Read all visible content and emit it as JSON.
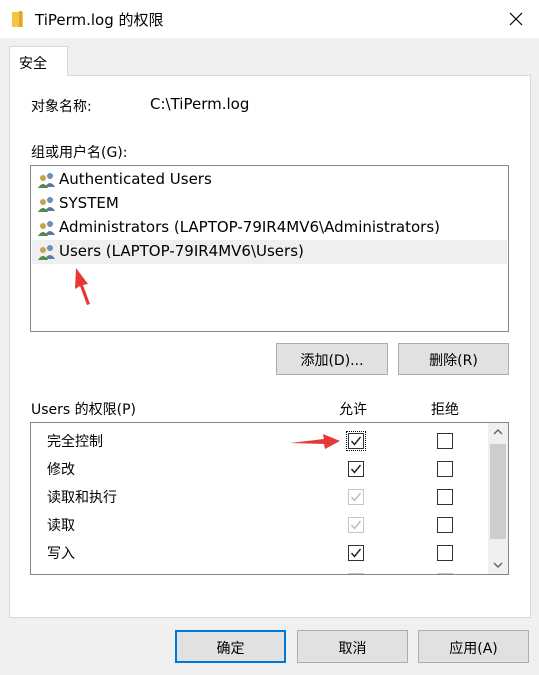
{
  "window": {
    "title": "TiPerm.log 的权限",
    "icons": {
      "title": "folder-icon",
      "close": "close-icon"
    }
  },
  "tabs": [
    {
      "label": "安全",
      "active": true
    }
  ],
  "object": {
    "label": "对象名称:",
    "value": "C:\\TiPerm.log"
  },
  "groups": {
    "label": "组或用户名(G):",
    "items": [
      {
        "name": "Authenticated Users",
        "icon": "users-group-icon",
        "selected": false
      },
      {
        "name": "SYSTEM",
        "icon": "users-group-icon",
        "selected": false
      },
      {
        "name": "Administrators (LAPTOP-79IR4MV6\\Administrators)",
        "icon": "users-group-icon",
        "selected": false
      },
      {
        "name": "Users (LAPTOP-79IR4MV6\\Users)",
        "icon": "users-group-icon",
        "selected": true
      }
    ],
    "add_button": "添加(D)...",
    "remove_button": "删除(R)"
  },
  "permissions": {
    "label": "Users 的权限(P)",
    "allow_header": "允许",
    "deny_header": "拒绝",
    "rows": [
      {
        "name": "完全控制",
        "allow": true,
        "allow_disabled": false,
        "deny": false
      },
      {
        "name": "修改",
        "allow": true,
        "allow_disabled": false,
        "deny": false
      },
      {
        "name": "读取和执行",
        "allow": true,
        "allow_disabled": true,
        "deny": false
      },
      {
        "name": "读取",
        "allow": true,
        "allow_disabled": true,
        "deny": false
      },
      {
        "name": "写入",
        "allow": true,
        "allow_disabled": false,
        "deny": false
      }
    ]
  },
  "footer": {
    "ok": "确定",
    "cancel": "取消",
    "apply": "应用(A)"
  },
  "colors": {
    "accent": "#0078d7",
    "annotation_arrow": "#e53935",
    "selected_row": "#efefef"
  }
}
